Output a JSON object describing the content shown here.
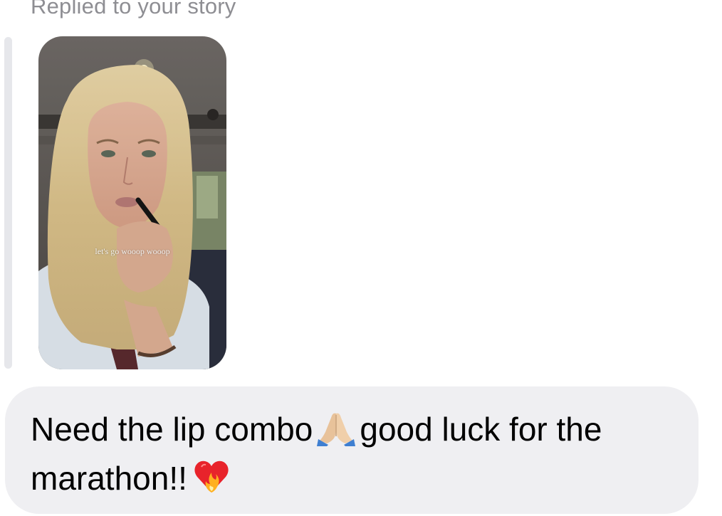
{
  "reply_context": {
    "caption": "Replied to your story"
  },
  "story": {
    "overlay_text": "let's go wooop wooop"
  },
  "message": {
    "line1_before_emoji": "Need the lip combo",
    "line1_after_emoji": "good luck for the",
    "line2": "marathon!!",
    "emojis": [
      "folded-hands-icon",
      "heart-on-fire-icon"
    ]
  },
  "colors": {
    "bubble_background": "#efeff2",
    "caption_text": "#8e8e93",
    "quote_bar": "#e6e7eb",
    "message_text": "#000000"
  }
}
